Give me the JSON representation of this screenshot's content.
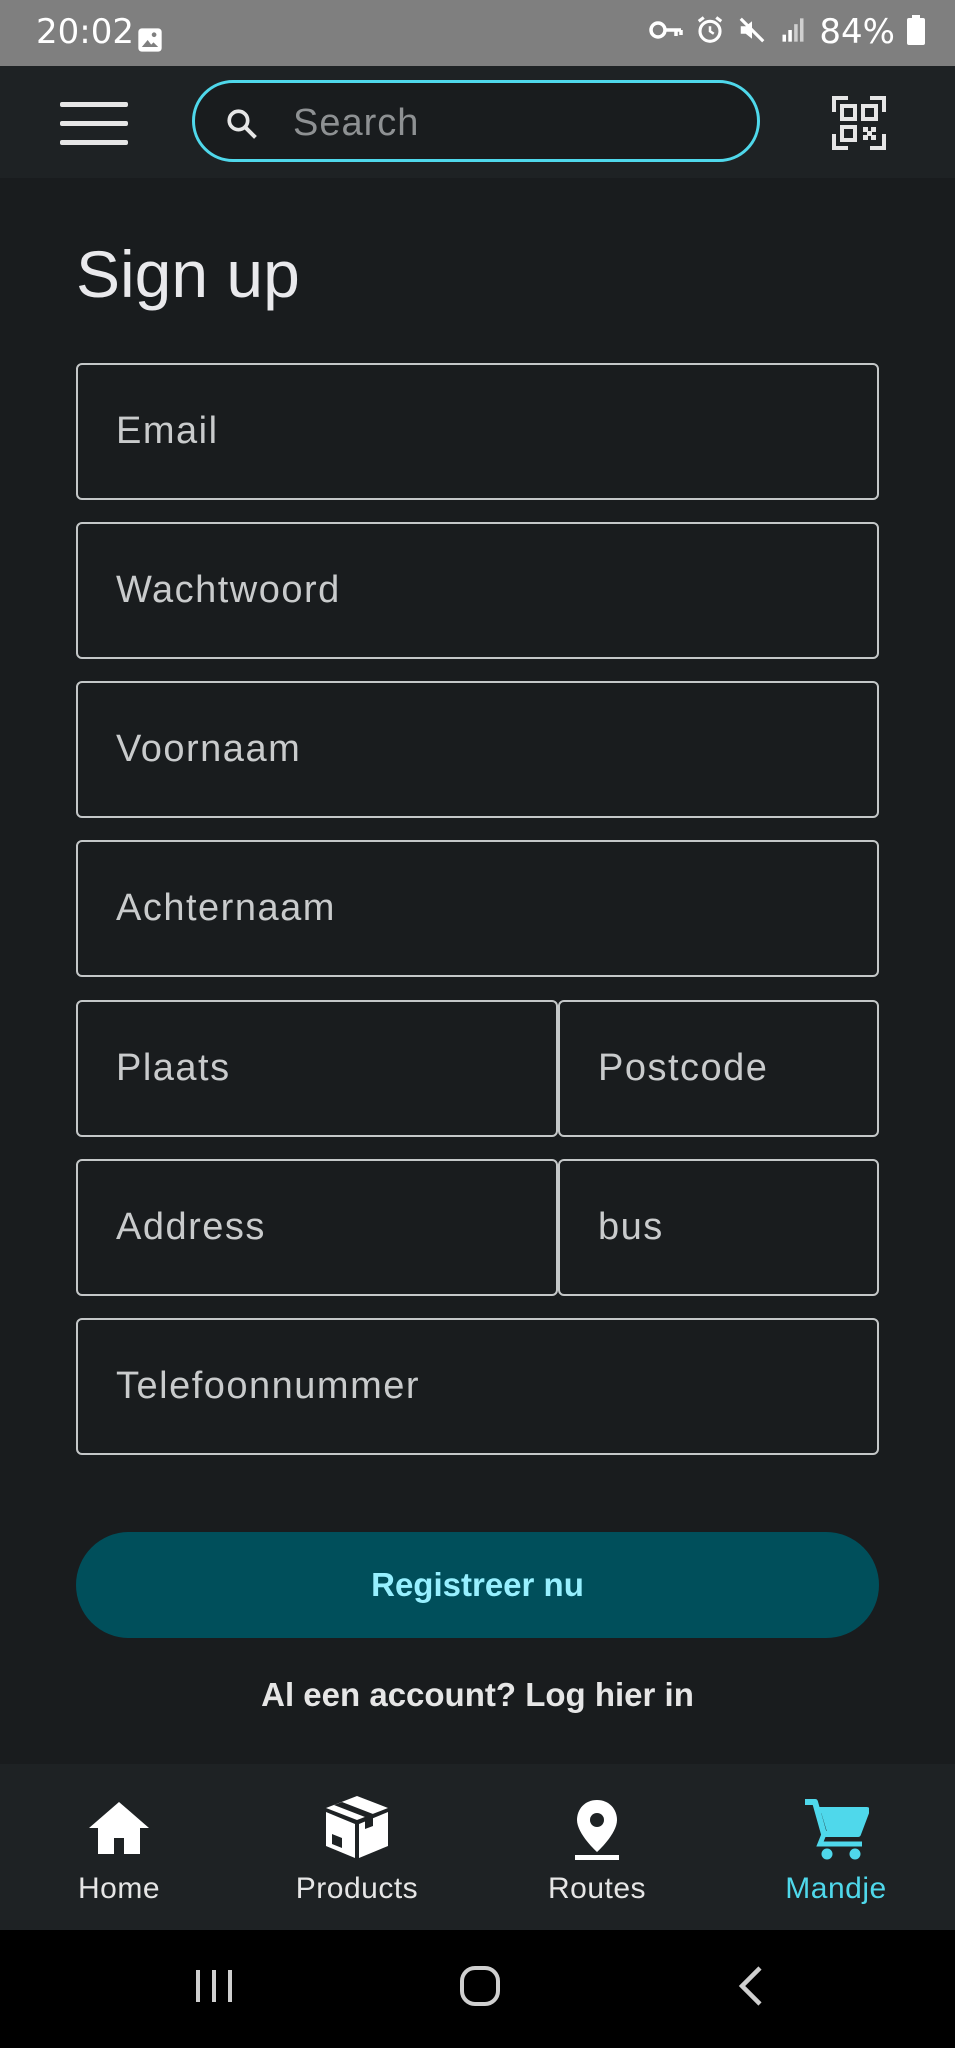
{
  "status_bar": {
    "time": "20:02",
    "battery": "84%",
    "icons": [
      "gallery-icon",
      "vpn-key-icon",
      "alarm-icon",
      "mute-icon",
      "signal-icon",
      "battery-icon"
    ]
  },
  "app_bar": {
    "search_placeholder": "Search",
    "icons": [
      "menu-icon",
      "search-icon",
      "qr-code-icon"
    ],
    "accent_color": "#4fd8eb"
  },
  "form": {
    "title": "Sign up",
    "fields": {
      "email": "Email",
      "password": "Wachtwoord",
      "first_name": "Voornaam",
      "last_name": "Achternaam",
      "city": "Plaats",
      "postcode": "Postcode",
      "address": "Address",
      "bus": "bus",
      "phone": "Telefoonnummer"
    },
    "submit_label": "Registreer nu",
    "login_link": "Al een account? Log hier in",
    "button_color": "#004f5b"
  },
  "bottom_nav": {
    "items": [
      {
        "label": "Home",
        "icon": "home-icon",
        "active": false
      },
      {
        "label": "Products",
        "icon": "package-icon",
        "active": false
      },
      {
        "label": "Routes",
        "icon": "location-pin-icon",
        "active": false
      },
      {
        "label": "Mandje",
        "icon": "cart-icon",
        "active": true
      }
    ]
  },
  "system_nav": {
    "icons": [
      "recent-apps-icon",
      "home-circle-icon",
      "back-icon"
    ]
  }
}
